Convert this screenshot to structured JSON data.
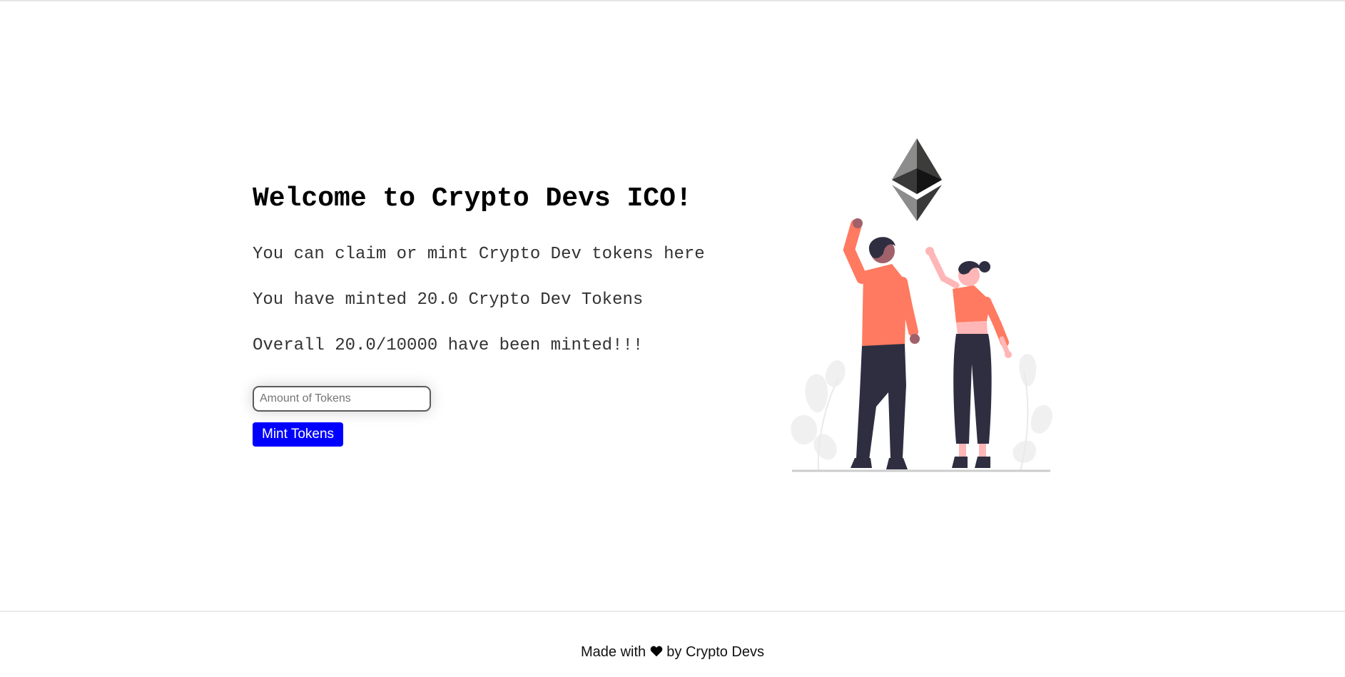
{
  "header": {
    "title": "Welcome to Crypto Devs ICO!",
    "description": "You can claim or mint Crypto Dev tokens here",
    "minted_by_user": "You have minted 20.0 Crypto Dev Tokens",
    "overall_minted": "Overall 20.0/10000 have been minted!!!"
  },
  "form": {
    "amount_placeholder": "Amount of Tokens",
    "amount_value": "",
    "mint_label": "Mint Tokens"
  },
  "illustration": {
    "icon": "ethereum-logo-icon",
    "subject": "two-people-cheering-illustration"
  },
  "footer": {
    "prefix": "Made with",
    "heart_icon": "heart-icon",
    "suffix": "by Crypto Devs"
  },
  "colors": {
    "button": "#0000ff",
    "shirt": "#ff7a60",
    "pants": "#2f2e41",
    "skin_light": "#ffb6b6",
    "skin_dark": "#a0616a"
  }
}
